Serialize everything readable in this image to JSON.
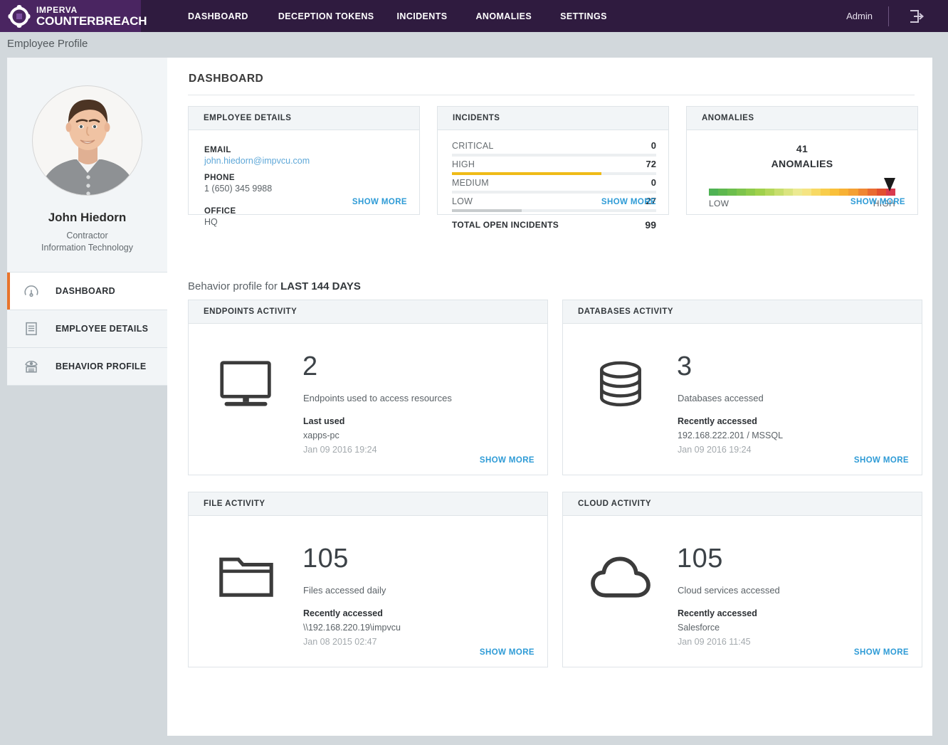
{
  "brand": {
    "line1": "IMPERVA",
    "line2": "COUNTERBREACH",
    "logo_icon": "imperva-logo-icon",
    "bar_color": "#2f1b3f",
    "logo_block_color": "#4a2561"
  },
  "topnav": {
    "items": [
      {
        "label": "DASHBOARD"
      },
      {
        "label": "DECEPTION TOKENS"
      },
      {
        "label": "INCIDENTS"
      },
      {
        "label": "ANOMALIES"
      },
      {
        "label": "SETTINGS"
      }
    ],
    "user": "Admin",
    "logout_icon": "logout-icon"
  },
  "breadcrumb": "Employee Profile",
  "sidebar": {
    "profile": {
      "avatar_icon": "user-photo-avatar",
      "name": "John Hiedorn",
      "role": "Contractor",
      "department": "Information Technology"
    },
    "items": [
      {
        "label": "DASHBOARD",
        "icon": "gauge-icon",
        "active": true
      },
      {
        "label": "EMPLOYEE DETAILS",
        "icon": "document-lines-icon",
        "active": false
      },
      {
        "label": "BEHAVIOR PROFILE",
        "icon": "behavior-eye-icon",
        "active": false
      }
    ],
    "active_indicator_color": "#e8742c"
  },
  "main": {
    "page_title": "DASHBOARD",
    "show_more_label": "SHOW MORE",
    "link_color": "#2e9bd6",
    "employee_details": {
      "title": "EMPLOYEE DETAILS",
      "fields": [
        {
          "key": "EMAIL",
          "value": "john.hiedorn@impvcu.com",
          "is_link": true
        },
        {
          "key": "PHONE",
          "value": "1 (650) 345 9988",
          "is_link": false
        },
        {
          "key": "OFFICE",
          "value": "HQ",
          "is_link": false
        }
      ]
    },
    "incidents": {
      "title": "INCIDENTS",
      "rows": [
        {
          "label": "CRITICAL",
          "value": "0",
          "pct": 0,
          "color": "#d94a3d"
        },
        {
          "label": "HIGH",
          "value": "72",
          "pct": 73,
          "color": "#efbb17"
        },
        {
          "label": "MEDIUM",
          "value": "0",
          "pct": 0,
          "color": "#f0a33a"
        },
        {
          "label": "LOW",
          "value": "27",
          "pct": 34,
          "color": "#c8ccce"
        }
      ],
      "total_label": "TOTAL OPEN INCIDENTS",
      "total_value": "99"
    },
    "anomalies": {
      "title": "ANOMALIES",
      "count": "41",
      "count_label": "ANOMALIES",
      "gauge": {
        "low_label": "LOW",
        "high_label": "HIGH",
        "marker_pct": 97,
        "segments": [
          "#4fb254",
          "#5eb84f",
          "#6cbe4d",
          "#7dc44c",
          "#8ecb4b",
          "#a0d14c",
          "#b4d75a",
          "#c8de6d",
          "#dbe47f",
          "#ecea92",
          "#f5e483",
          "#f7d964",
          "#f8cd4b",
          "#f9c03a",
          "#f7b134",
          "#f4a033",
          "#ef8732",
          "#e96b31",
          "#e2502f",
          "#d93a4e"
        ]
      }
    },
    "behavior_header_prefix": "Behavior profile for ",
    "behavior_header_range": "LAST 144 DAYS",
    "activity_cards": [
      {
        "title": "ENDPOINTS ACTIVITY",
        "icon": "monitor-icon",
        "number": "2",
        "description": "Endpoints used to access resources",
        "recent_key": "Last used",
        "recent_value": "xapps-pc",
        "recent_time": "Jan 09 2016 19:24"
      },
      {
        "title": "DATABASES ACTIVITY",
        "icon": "database-icon",
        "number": "3",
        "description": "Databases accessed",
        "recent_key": "Recently accessed",
        "recent_value": "192.168.222.201 / MSSQL",
        "recent_time": "Jan 09 2016 19:24"
      },
      {
        "title": "FILE ACTIVITY",
        "icon": "folder-icon",
        "number": "105",
        "description": "Files accessed daily",
        "recent_key": "Recently accessed",
        "recent_value": "\\\\192.168.220.19\\impvcu",
        "recent_time": "Jan 08 2015 02:47"
      },
      {
        "title": "CLOUD ACTIVITY",
        "icon": "cloud-icon",
        "number": "105",
        "description": "Cloud services accessed",
        "recent_key": "Recently accessed",
        "recent_value": "Salesforce",
        "recent_time": "Jan 09 2016 11:45"
      }
    ]
  }
}
